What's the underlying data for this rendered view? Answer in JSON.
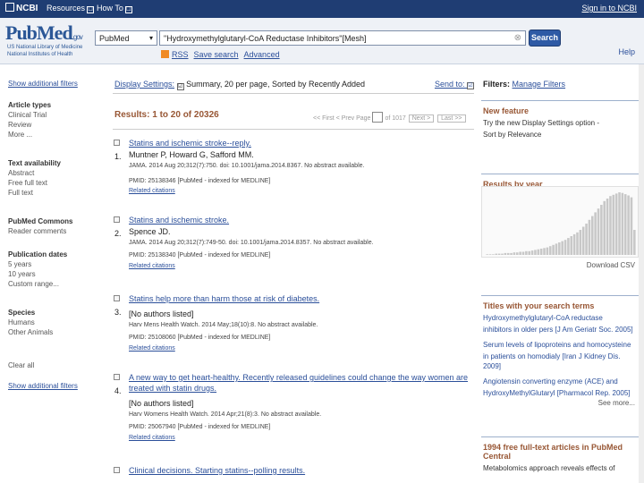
{
  "topbar": {
    "logo": "NCBI",
    "resources": "Resources",
    "howto": "How To",
    "dd_glyph": "☐",
    "signin": "Sign in to NCBI"
  },
  "header": {
    "logo_main": "PubMed",
    "logo_gov": ".gov",
    "sub1": "US National Library of Medicine",
    "sub2": "National Institutes of Health",
    "db": "PubMed",
    "query": "\"Hydroxymethylglutaryl-CoA Reductase Inhibitors\"[Mesh]",
    "search": "Search",
    "rss": "RSS",
    "save": "Save search",
    "advanced": "Advanced",
    "help": "Help",
    "clear_glyph": "⊗"
  },
  "left": {
    "show_top": "Show additional filters",
    "groups": [
      {
        "head": "Article types",
        "items": [
          "Clinical Trial",
          "Review",
          "More ..."
        ]
      },
      {
        "head": "Text availability",
        "items": [
          "Abstract",
          "Free full text",
          "Full text"
        ]
      },
      {
        "head": "PubMed Commons",
        "items": [
          "Reader comments"
        ]
      },
      {
        "head": "Publication dates",
        "items": [
          "5 years",
          "10 years",
          "Custom range..."
        ]
      },
      {
        "head": "Species",
        "items": [
          "Humans",
          "Other Animals"
        ]
      }
    ],
    "clear_all": "Clear all",
    "show_bottom": "Show additional filters"
  },
  "main": {
    "display_settings": "Display Settings:",
    "display_check": "☑",
    "display_summary": "Summary, 20 per page, Sorted by Recently Added",
    "send_to": "Send to:",
    "results": "Results: 1 to 20 of 20326",
    "pager": {
      "first": "<< First",
      "prev": "< Prev",
      "page": "Page",
      "of": "of 1017",
      "next": "Next >",
      "last": "Last >>"
    },
    "items": [
      {
        "num": "1.",
        "title": "Statins and ischemic stroke--reply.",
        "authors": "Muntner P, Howard G, Safford MM.",
        "journal": "JAMA. 2014 Aug 20;312(7):750. doi: 10.1001/jama.2014.8367. No abstract available.",
        "pmid": "PMID: 25138346 [PubMed - indexed for MEDLINE]",
        "related": "Related citations"
      },
      {
        "num": "2.",
        "title": "Statins and ischemic stroke.",
        "authors": "Spence JD.",
        "journal": "JAMA. 2014 Aug 20;312(7):749-50. doi: 10.1001/jama.2014.8357. No abstract available.",
        "pmid": "PMID: 25138340 [PubMed - indexed for MEDLINE]",
        "related": "Related citations"
      },
      {
        "num": "3.",
        "title": "Statins help more than harm those at risk of diabetes.",
        "authors": "[No authors listed]",
        "journal": "Harv Mens Health Watch. 2014 May;18(10):8. No abstract available.",
        "pmid": "PMID: 25108060 [PubMed - indexed for MEDLINE]",
        "related": "Related citations"
      },
      {
        "num": "4.",
        "title": "A new way to get heart-healthy. Recently released guidelines could change the way women are treated with statin drugs.",
        "authors": "[No authors listed]",
        "journal": "Harv Womens Health Watch. 2014 Apr;21(8):3. No abstract available.",
        "pmid": "PMID: 25067940 [PubMed - indexed for MEDLINE]",
        "related": "Related citations"
      },
      {
        "num": "5.",
        "title": "Clinical decisions. Starting statins--polling results.",
        "authors": "",
        "journal": "",
        "pmid": "",
        "related": ""
      }
    ]
  },
  "right": {
    "filters": "Filters:",
    "manage": "Manage Filters",
    "new_feature": {
      "head": "New feature",
      "text1": "Try the new Display Settings option -",
      "text2": "Sort by Relevance"
    },
    "year_box": {
      "head": "Results by year",
      "download": "Download CSV"
    },
    "titles_box": {
      "head": "Titles with your search terms",
      "lines": [
        "Hydroxymethylglutaryl-CoA reductase",
        "inhibitors in older pers [J Am Geriatr Soc. 2005]",
        "Serum levels of lipoproteins and homocysteine",
        "in patients on homodialy [Iran J Kidney Dis. 2009]",
        "Angiotensin converting enzyme (ACE) and",
        "HydroxyMethylGlutaryl [Pharmacol Rep. 2005]"
      ],
      "more": "See more..."
    },
    "free_box": {
      "head": "1994 free full-text articles in PubMed Central",
      "text": "Metabolomics approach reveals effects of"
    }
  },
  "chart_data": {
    "type": "bar",
    "title": "Results by year",
    "values": [
      1,
      1,
      1,
      2,
      2,
      2,
      3,
      3,
      3,
      4,
      4,
      5,
      5,
      6,
      6,
      7,
      8,
      9,
      10,
      11,
      12,
      14,
      16,
      18,
      20,
      22,
      24,
      27,
      30,
      33,
      36,
      40,
      45,
      50,
      56,
      62,
      68,
      74,
      80,
      86,
      90,
      94,
      96,
      98,
      100,
      99,
      97,
      95,
      92,
      40
    ]
  }
}
